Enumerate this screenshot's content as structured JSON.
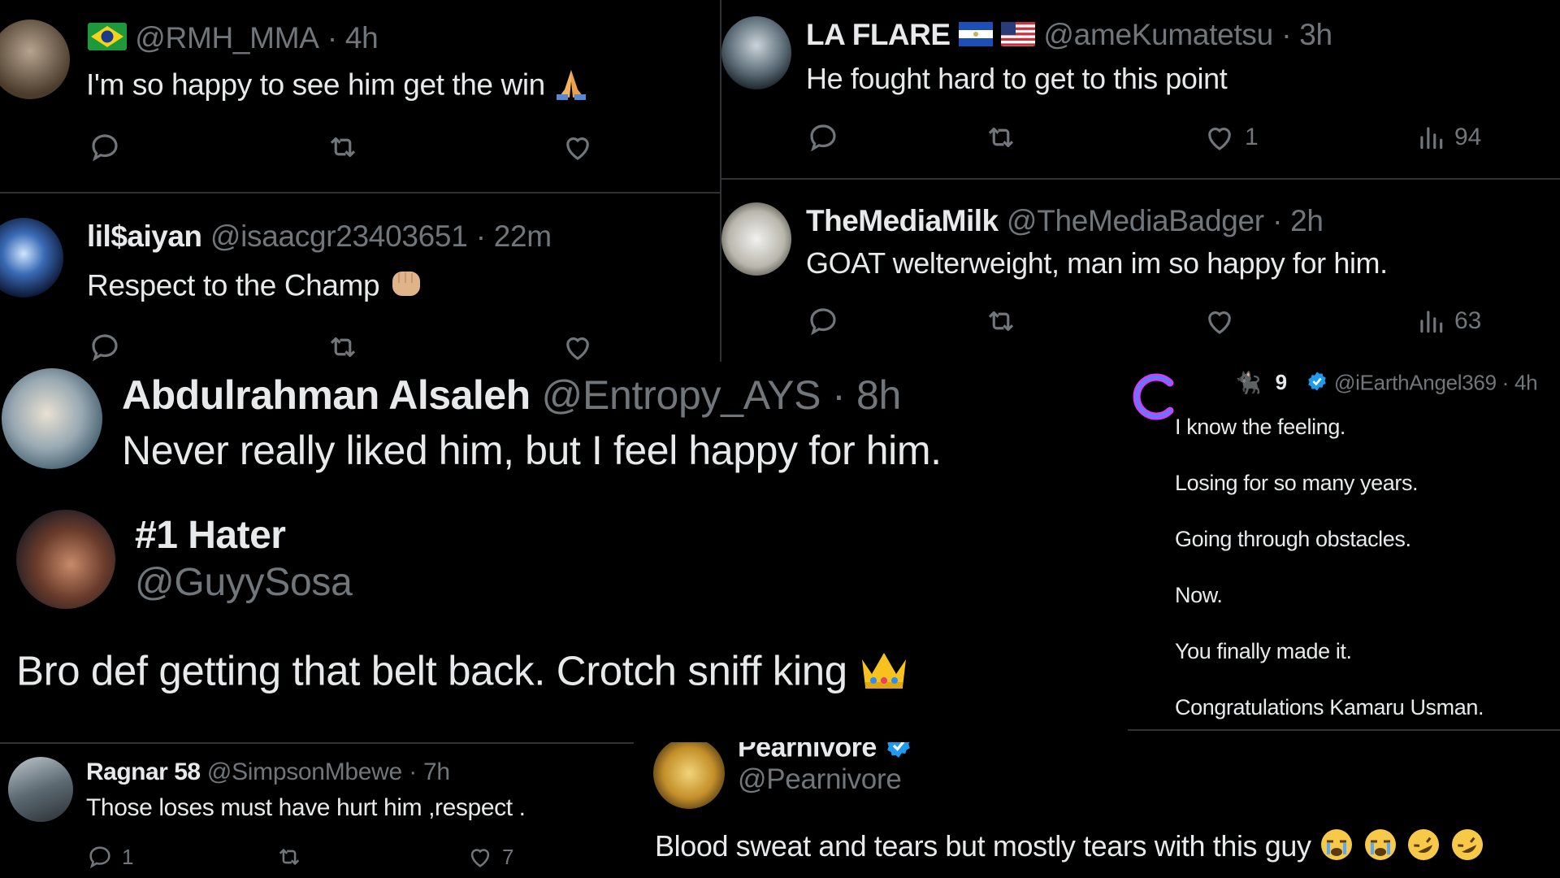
{
  "tweets": {
    "rmh": {
      "handle": "@RMH_MMA",
      "time": "· 4h",
      "text": "I'm so happy to see him get the win",
      "flag": "brazil-flag"
    },
    "laflare": {
      "name": "LA FLARE",
      "handle": "@ameKumatetsu",
      "time": "· 3h",
      "text": "He fought hard to get to this point",
      "likes": "1",
      "views": "94"
    },
    "saiyan": {
      "name": "lil$aiyan",
      "handle": "@isaacgr23403651",
      "time": "· 22m",
      "text": "Respect to the Champ"
    },
    "mediamilk": {
      "name": "TheMediaMilk",
      "handle": "@TheMediaBadger",
      "time": "· 2h",
      "text": "GOAT welterweight, man im so happy for him.",
      "views": "63"
    },
    "abdul": {
      "name": "Abdulrahman Alsaleh",
      "handle": "@Entropy_AYS",
      "time": "· 8h",
      "text": "Never really liked him, but I feel happy for him."
    },
    "hater": {
      "name": "#1 Hater",
      "handle": "@GuyySosa",
      "text": "Bro def getting that belt back. Crotch sniff king"
    },
    "earth": {
      "name": "9",
      "handle": "@iEarthAngel369 · 4h",
      "lines": [
        "I know the feeling.",
        "Losing for so many years.",
        "Going through obstacles.",
        "Now.",
        "You finally made it.",
        "Congratulations Kamaru Usman."
      ]
    },
    "ragnar": {
      "name": "Ragnar 58",
      "handle": "@SimpsonMbewe",
      "time": "· 7h",
      "text": "Those loses must have hurt him ,respect .",
      "replies": "1",
      "likes": "7"
    },
    "pearnivore": {
      "name": "Pearnivore",
      "handle": "@Pearnivore",
      "text": "Blood sweat and tears but mostly tears with this guy"
    }
  },
  "colors": {
    "background": "#000000",
    "text": "#e7e9ea",
    "muted": "#71767b",
    "verified": "#1d9bf0",
    "divider": "#2f3336"
  }
}
